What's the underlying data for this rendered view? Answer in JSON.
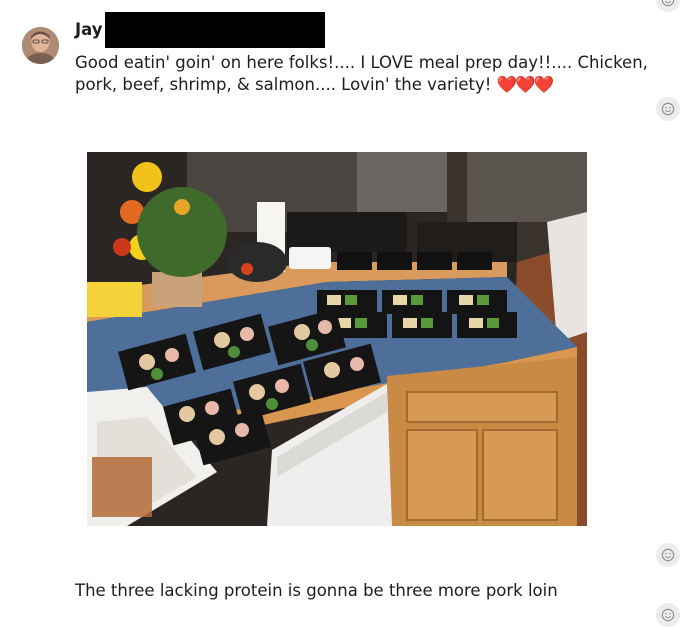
{
  "message": {
    "author": "Jay",
    "text": "Good eatin' goin' on here folks!.... I LOVE meal prep day!!.... Chicken, pork, beef, shrimp, & salmon.... Lovin' the variety!",
    "emoji": "❤️❤️❤️"
  },
  "reply": {
    "text": "The three lacking protein is gonna be three more pork loin"
  },
  "icons": {
    "reaction": "smiley-icon",
    "avatar": "user-avatar"
  }
}
